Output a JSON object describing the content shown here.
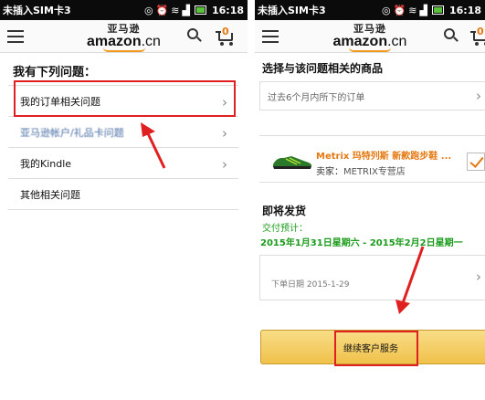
{
  "status_bar": {
    "carrier": "未插入SIM卡3",
    "time": "16:18"
  },
  "logo": {
    "cn_text": "亚马逊",
    "brand_text": "amazon",
    "brand_suffix": ".cn"
  },
  "cart": {
    "count": "0"
  },
  "left_screen": {
    "heading": "我有下列问题：",
    "issues": [
      {
        "label": "我的订单相关问题"
      },
      {
        "label": "亚马逊帐户/礼品卡问题"
      },
      {
        "label": "我的Kindle"
      },
      {
        "label": "其他相关问题"
      }
    ]
  },
  "right_screen": {
    "heading": "选择与该问题相关的商品",
    "order_filter": "过去6个月内所下的订单",
    "product": {
      "name": "Metrix 玛特列斯 新款跑步鞋 ...",
      "seller_label": "卖家：",
      "seller_value": "METRIX专营店"
    },
    "shipping": {
      "title": "即将发货",
      "eta_label": "交付预计：",
      "eta_dates": "2015年1月31日星期六 - 2015年2月2日星期一",
      "order_date": "下单日期 2015-1-29"
    },
    "continue_button": "继续客户服务"
  },
  "colors": {
    "highlight": "#e02020",
    "accent_orange": "#e47911",
    "eta_green": "#1b9b1b",
    "button_yellow": "#f0c14b"
  }
}
